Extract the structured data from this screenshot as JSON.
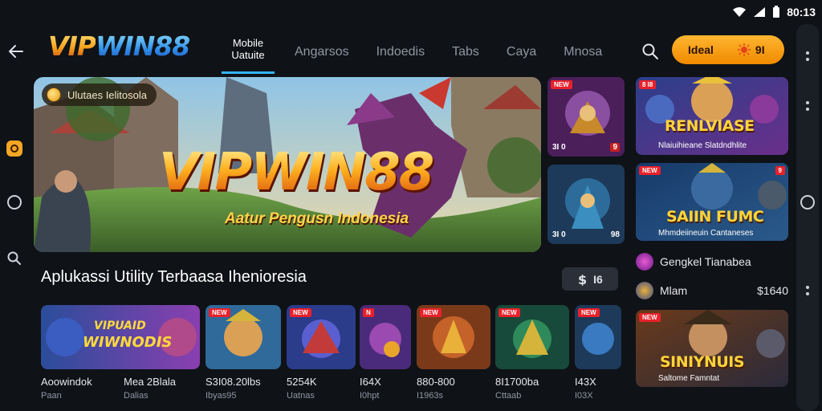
{
  "status": {
    "time": "80:13"
  },
  "header": {
    "logo_part1": "VIP",
    "logo_part2": "WIN88",
    "tabs": [
      {
        "label_line1": "Mobile",
        "label_line2": "Uatuite",
        "active": true
      },
      {
        "label": "Angarsos"
      },
      {
        "label": "Indoedis"
      },
      {
        "label": "Tabs"
      },
      {
        "label": "Caya"
      },
      {
        "label": "Mnosa"
      }
    ],
    "cta_left": "Ideal",
    "cta_right": "9I"
  },
  "hero": {
    "chip_label": "Ulutaes Ielitosola",
    "title": "VIPWIN88",
    "subtitle": "Aatur Pengusn Indonesia",
    "thumbs": [
      {
        "badge": "3I 0",
        "corner": "9"
      },
      {
        "badge": "3I 0",
        "corner": "98"
      }
    ]
  },
  "section": {
    "title": "Aplukassi Utility Terbaasa Ihenioresia",
    "see_all": "I6"
  },
  "cards": [
    {
      "title": "Aoowindok",
      "sub": "Paan",
      "art_text_1": "VIPUAID",
      "art_text_2": "WIWNODIS"
    },
    {
      "title": "Mea 2Blala",
      "sub": "Dalias"
    },
    {
      "title": "S3I08.20lbs",
      "sub": "Ibyas95"
    },
    {
      "title": "5254K",
      "sub": "Uatnas"
    },
    {
      "title": "I64X",
      "sub": "I0hpt"
    },
    {
      "title": "880-800",
      "sub": "I1963s"
    },
    {
      "title": "8I1700ba",
      "sub": "Cttaab"
    },
    {
      "title": "I43X",
      "sub": "I03X"
    }
  ],
  "side": {
    "promos": [
      {
        "badge": "8 I8",
        "title": "RENLVIASE",
        "sub": "Nlaiuihieane Slatdndhlite"
      },
      {
        "badge": "9",
        "title": "SAIIN FUMC",
        "sub": "Mhmdeiineuin Cantaneses"
      },
      {
        "badge": "",
        "title": "SINIYNUIS",
        "sub": "Saltome Famntat"
      }
    ],
    "list": [
      {
        "label": "Gengkel Tianabea",
        "value": ""
      },
      {
        "label": "Mlam",
        "value": "$1640"
      }
    ]
  },
  "colors": {
    "accent": "#35b5ff",
    "cta": "#f7a11a",
    "bg": "#0f1217"
  }
}
